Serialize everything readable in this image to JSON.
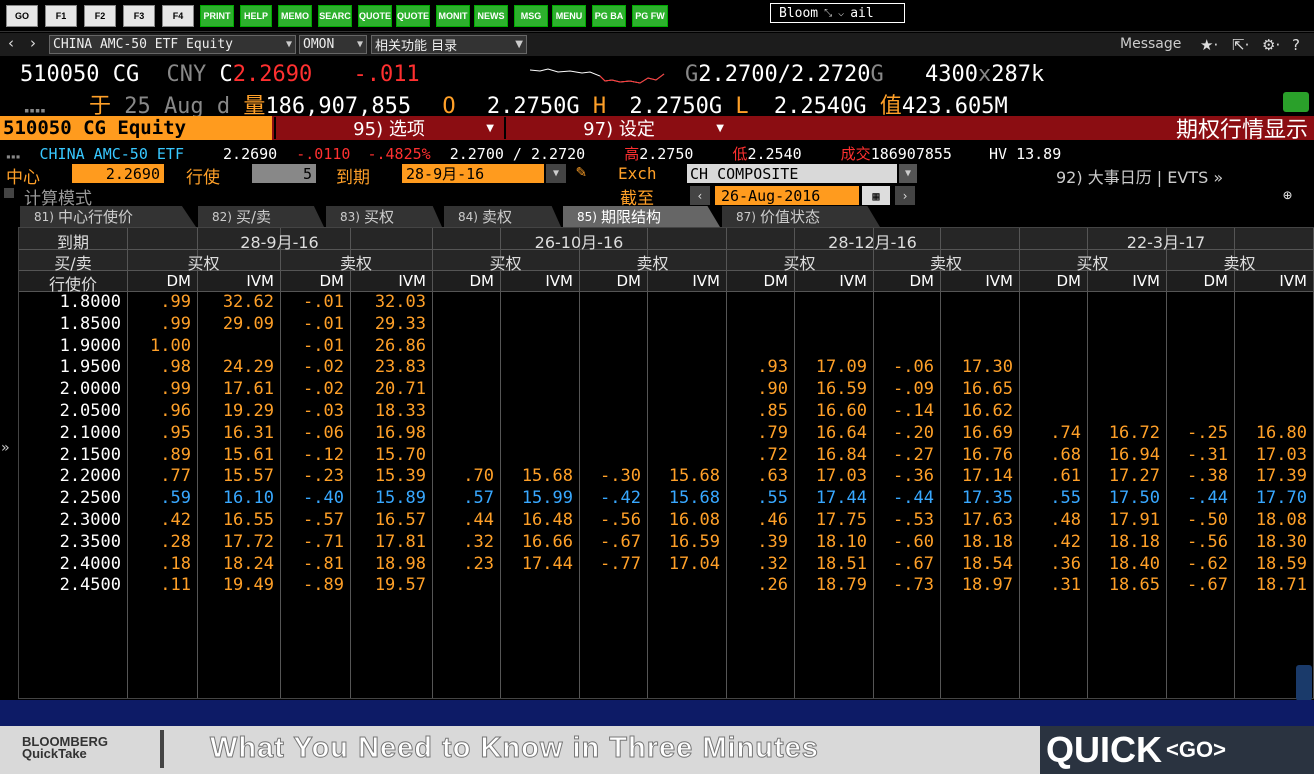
{
  "fkeys": [
    "GO",
    "F1",
    "F2",
    "F3",
    "F4",
    "PRINT",
    "HELP",
    "MEMO",
    "SEARC",
    "QUOTE",
    "QUOTE",
    "MONIT",
    "NEWS",
    "MSG",
    "MENU",
    "PG BA",
    "PG FW"
  ],
  "bloomberg_box": {
    "left": "Bloom",
    "right": "ail"
  },
  "nav": {
    "security": "CHINA AMC-50 ETF Equity",
    "function": "OMON",
    "related": "相关功能  目录",
    "message": "Message"
  },
  "quote": {
    "ticker": "510050 CG",
    "ccy": "CNY",
    "c": "C",
    "last": "2.2690",
    "chg": "-.011",
    "g_label": "G",
    "bid": "2.2700",
    "sep": "/",
    "ask": "2.2720",
    "g2": "G",
    "size": "4300",
    "x": "x",
    "size2": "287k",
    "date_char": "于",
    "date": "25 Aug d",
    "vol_char": "量",
    "volume": "186,907,855",
    "o_label": "O",
    "open": "2.2750G",
    "h_label": "H",
    "high": "2.2750G",
    "l_label": "L",
    "low": "2.2540G",
    "val_char": "值",
    "value": "423.605M"
  },
  "title": {
    "equity": "510050 CG Equity",
    "btn95": "95) 选项",
    "btn97": "97) 设定",
    "right": "期权行情显示"
  },
  "info": {
    "name": "CHINA AMC-50 ETF",
    "last": "2.2690",
    "chg": "-.0110",
    "pct": "-.4825%",
    "bid": "2.2700",
    "slash": "/",
    "ask": "2.2720",
    "high_label": "高",
    "high": "2.2750",
    "low_label": "低",
    "low": "2.2540",
    "vol_label": "成交",
    "vol": "186907855",
    "hv": "HV 13.89"
  },
  "controls": {
    "center_label": "中心",
    "center": "2.2690",
    "strikes_label": "行使",
    "strikes": "5",
    "expiry_label": "到期",
    "expiry": "28-9月-16",
    "exch_label": "Exch",
    "exch": "CH COMPOSITE",
    "events": "92) 大事日历 | EVTS »",
    "calc": "计算模式",
    "asof_label": "截至",
    "asof": "26-Aug-2016"
  },
  "tabs": [
    {
      "n": "81)",
      "label": "中心行使价"
    },
    {
      "n": "82)",
      "label": "买/卖"
    },
    {
      "n": "83)",
      "label": "买权"
    },
    {
      "n": "84)",
      "label": "卖权"
    },
    {
      "n": "85)",
      "label": "期限结构"
    },
    {
      "n": "87)",
      "label": "价值状态"
    }
  ],
  "grid": {
    "h_expiry": "到期",
    "h_cp": "买/卖",
    "h_strike": "行使价",
    "expiries": [
      "28-9月-16",
      "26-10月-16",
      "28-12月-16",
      "22-3月-17"
    ],
    "call": "买权",
    "put": "卖权",
    "dm": "DM",
    "ivm": "IVM",
    "rows": [
      {
        "k": "1.8000",
        "v": [
          ".99",
          "32.62",
          "-.01",
          "32.03",
          "",
          "",
          "",
          "",
          "",
          "",
          "",
          "",
          "",
          "",
          "",
          ""
        ]
      },
      {
        "k": "1.8500",
        "v": [
          ".99",
          "29.09",
          "-.01",
          "29.33",
          "",
          "",
          "",
          "",
          "",
          "",
          "",
          "",
          "",
          "",
          "",
          ""
        ]
      },
      {
        "k": "1.9000",
        "v": [
          "1.00",
          "",
          "-.01",
          "26.86",
          "",
          "",
          "",
          "",
          "",
          "",
          "",
          "",
          "",
          "",
          "",
          ""
        ]
      },
      {
        "k": "1.9500",
        "v": [
          ".98",
          "24.29",
          "-.02",
          "23.83",
          "",
          "",
          "",
          "",
          ".93",
          "17.09",
          "-.06",
          "17.30",
          "",
          "",
          "",
          ""
        ]
      },
      {
        "k": "2.0000",
        "v": [
          ".99",
          "17.61",
          "-.02",
          "20.71",
          "",
          "",
          "",
          "",
          ".90",
          "16.59",
          "-.09",
          "16.65",
          "",
          "",
          "",
          ""
        ]
      },
      {
        "k": "2.0500",
        "v": [
          ".96",
          "19.29",
          "-.03",
          "18.33",
          "",
          "",
          "",
          "",
          ".85",
          "16.60",
          "-.14",
          "16.62",
          "",
          "",
          "",
          ""
        ]
      },
      {
        "k": "2.1000",
        "v": [
          ".95",
          "16.31",
          "-.06",
          "16.98",
          "",
          "",
          "",
          "",
          ".79",
          "16.64",
          "-.20",
          "16.69",
          ".74",
          "16.72",
          "-.25",
          "16.80"
        ]
      },
      {
        "k": "2.1500",
        "v": [
          ".89",
          "15.61",
          "-.12",
          "15.70",
          "",
          "",
          "",
          "",
          ".72",
          "16.84",
          "-.27",
          "16.76",
          ".68",
          "16.94",
          "-.31",
          "17.03"
        ]
      },
      {
        "k": "2.2000",
        "v": [
          ".77",
          "15.57",
          "-.23",
          "15.39",
          ".70",
          "15.68",
          "-.30",
          "15.68",
          ".63",
          "17.03",
          "-.36",
          "17.14",
          ".61",
          "17.27",
          "-.38",
          "17.39"
        ]
      },
      {
        "k": "2.2500",
        "atm": true,
        "v": [
          ".59",
          "16.10",
          "-.40",
          "15.89",
          ".57",
          "15.99",
          "-.42",
          "15.68",
          ".55",
          "17.44",
          "-.44",
          "17.35",
          ".55",
          "17.50",
          "-.44",
          "17.70"
        ]
      },
      {
        "k": "2.3000",
        "v": [
          ".42",
          "16.55",
          "-.57",
          "16.57",
          ".44",
          "16.48",
          "-.56",
          "16.08",
          ".46",
          "17.75",
          "-.53",
          "17.63",
          ".48",
          "17.91",
          "-.50",
          "18.08"
        ]
      },
      {
        "k": "2.3500",
        "v": [
          ".28",
          "17.72",
          "-.71",
          "17.81",
          ".32",
          "16.66",
          "-.67",
          "16.59",
          ".39",
          "18.10",
          "-.60",
          "18.18",
          ".42",
          "18.18",
          "-.56",
          "18.30"
        ]
      },
      {
        "k": "2.4000",
        "v": [
          ".18",
          "18.24",
          "-.81",
          "18.98",
          ".23",
          "17.44",
          "-.77",
          "17.04",
          ".32",
          "18.51",
          "-.67",
          "18.54",
          ".36",
          "18.40",
          "-.62",
          "18.59"
        ]
      },
      {
        "k": "2.4500",
        "v": [
          ".11",
          "19.49",
          "-.89",
          "19.57",
          "",
          "",
          "",
          "",
          ".26",
          "18.79",
          "-.73",
          "18.97",
          ".31",
          "18.65",
          "-.67",
          "18.71"
        ]
      }
    ]
  },
  "banner": {
    "logo1": "BLOOMBERG",
    "logo2": "QuickTake",
    "text": "What You Need to Know in Three Minutes",
    "quick": "QUICK",
    "go": "<GO>"
  },
  "colors": {
    "orange": "#ffa028",
    "red": "#ff3030",
    "atm_blue": "#38a8ff",
    "cyan": "#38c8ff",
    "title_red": "#8b0d12"
  }
}
